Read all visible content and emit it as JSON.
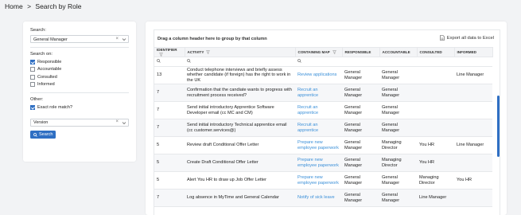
{
  "breadcrumb": {
    "home": "Home",
    "sep": ">",
    "current": "Search by Role"
  },
  "left": {
    "search_label": "Search:",
    "search_value": "General Manager",
    "search_on_label": "Search on:",
    "options": [
      {
        "label": "Responsible",
        "checked": true
      },
      {
        "label": "Accountable",
        "checked": false
      },
      {
        "label": "Consulted",
        "checked": false
      },
      {
        "label": "Informed",
        "checked": false
      }
    ],
    "other_label": "Other:",
    "exact_label": "Exact role match?",
    "exact_checked": true,
    "version_value": "Version",
    "search_button": "Search"
  },
  "grid": {
    "group_hint": "Drag a column header here to group by that column",
    "export_label": "Export all data to Excel",
    "columns": [
      "IDENTIFIER",
      "ACTIVITY",
      "CONTAINING MAP",
      "RESPONSIBLE",
      "ACCOUNTABLE",
      "CONSULTED",
      "INFORMED"
    ],
    "rows": [
      [
        "13",
        "Conduct telephone interviews and briefly assess whether candidate (if foreign) has the right to work in the UK",
        "Review applications",
        "General Manager",
        "General Manager",
        "",
        "Line Manager"
      ],
      [
        "7",
        "Confirmation that the candiate wants to progress with recruitment process received?",
        "Recruit an apprentice",
        "General Manager",
        "General Manager",
        "",
        ""
      ],
      [
        "7",
        "Send initial introductory Apprentice Software Developer email (cc MC and CM)",
        "Recruit an apprentice",
        "General Manager",
        "General Manager",
        "",
        ""
      ],
      [
        "7",
        "Send initial introductory Technical apprentice email (cc customer.services@)",
        "Recruit an apprentice",
        "General Manager",
        "General Manager",
        "",
        ""
      ],
      [
        "5",
        "Review draft Conditional Offer Letter",
        "Prepare new employee paperwork",
        "General Manager",
        "Managing Director",
        "You HR",
        "Line Manager"
      ],
      [
        "5",
        "Create Draft Conditional Offer Letter",
        "Prepare new employee paperwork",
        "General Manager",
        "Managing Director",
        "You HR",
        ""
      ],
      [
        "5",
        "Alert You HR to draw up Job Offer Letter",
        "Prepare new employee paperwork",
        "General Manager",
        "General Manager",
        "Managing Director",
        "You HR"
      ],
      [
        "7",
        "Log absence in MyTime and General Calendar",
        "Notify of sick leave",
        "General Manager",
        "General Manager",
        "Line Manager",
        ""
      ]
    ]
  },
  "colors": {
    "accent": "#2f6fc3",
    "link": "#3a8fd8"
  }
}
